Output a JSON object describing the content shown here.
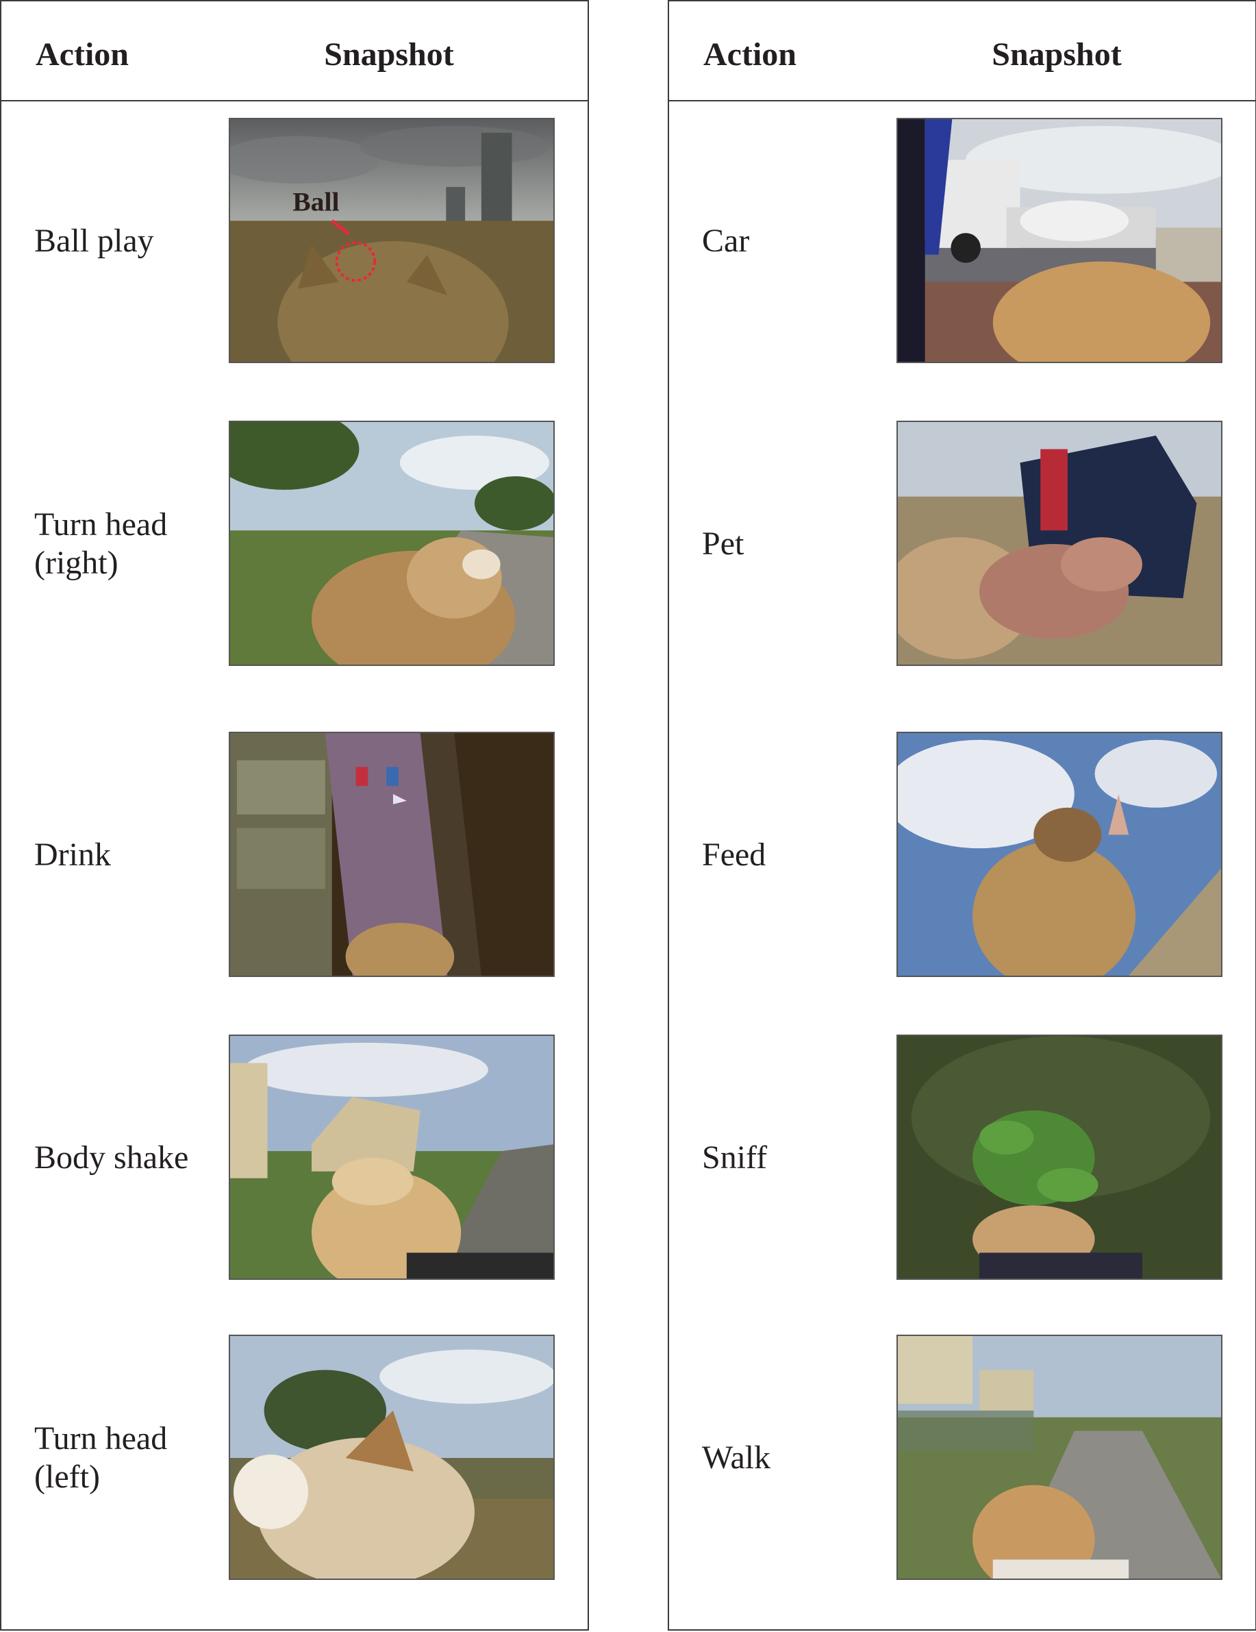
{
  "headers": {
    "action": "Action",
    "snapshot": "Snapshot"
  },
  "left": [
    {
      "action": "Ball play",
      "annotation": "Ball",
      "scene": "beach-ball-icon"
    },
    {
      "action": "Turn head\n(right)",
      "scene": "park-path-icon"
    },
    {
      "action": "Drink",
      "scene": "water-cooler-icon"
    },
    {
      "action": "Body shake",
      "scene": "houses-lawn-icon"
    },
    {
      "action": "Turn head\n(left)",
      "scene": "dog-profile-icon"
    }
  ],
  "right": [
    {
      "action": "Car",
      "scene": "tow-truck-icon"
    },
    {
      "action": "Pet",
      "scene": "hand-petting-icon"
    },
    {
      "action": "Feed",
      "scene": "hand-feeding-icon"
    },
    {
      "action": "Sniff",
      "scene": "sniff-plant-icon"
    },
    {
      "action": "Walk",
      "scene": "sidewalk-walk-icon"
    }
  ]
}
